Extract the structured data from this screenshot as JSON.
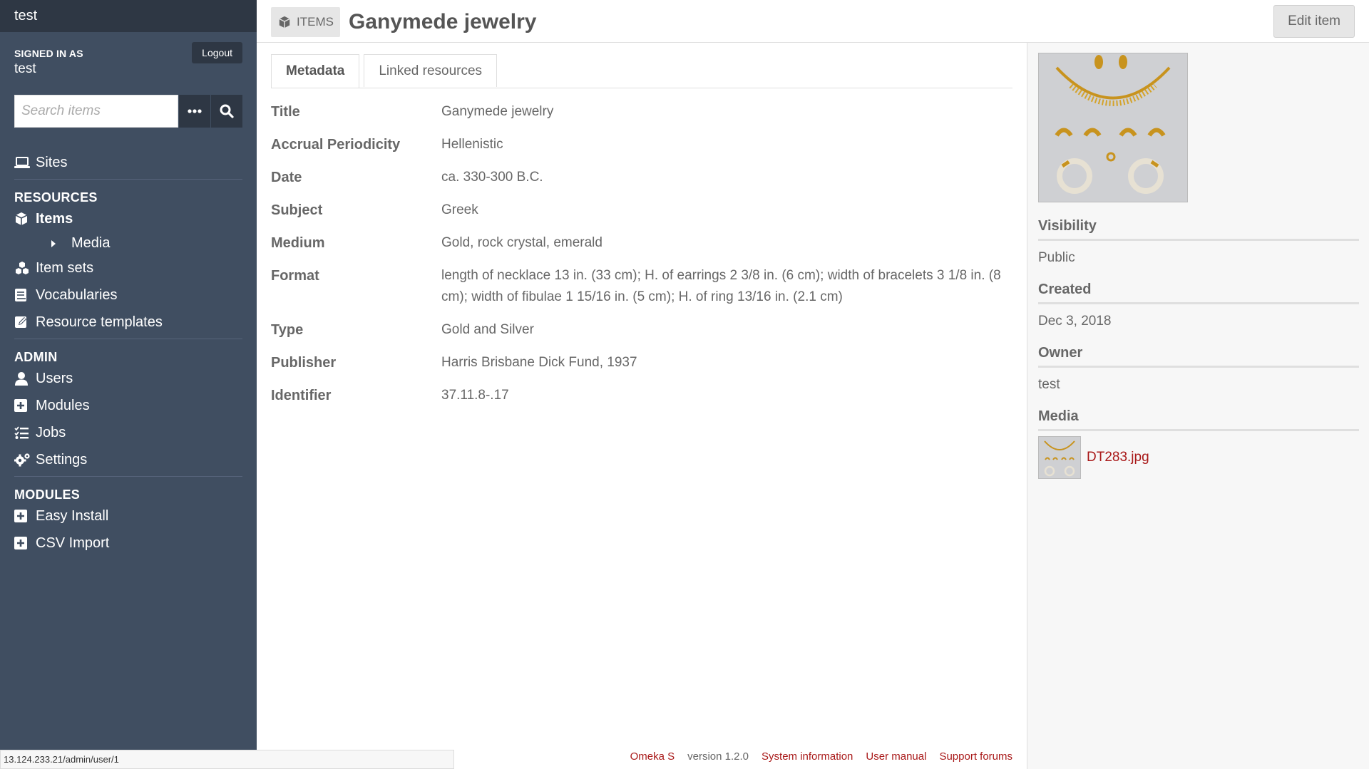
{
  "sidebar": {
    "site_title": "test",
    "signed_in_label": "SIGNED IN AS",
    "user_name": "test",
    "logout_label": "Logout",
    "search_placeholder": "Search items",
    "nav": {
      "sites": "Sites",
      "resources_heading": "RESOURCES",
      "items": "Items",
      "media": "Media",
      "item_sets": "Item sets",
      "vocabularies": "Vocabularies",
      "resource_templates": "Resource templates",
      "admin_heading": "ADMIN",
      "users": "Users",
      "modules": "Modules",
      "jobs": "Jobs",
      "settings": "Settings",
      "modules_heading": "MODULES",
      "easy_install": "Easy Install",
      "csv_import": "CSV Import"
    }
  },
  "header": {
    "section": "ITEMS",
    "title": "Ganymede jewelry",
    "edit_label": "Edit item"
  },
  "tabs": [
    "Metadata",
    "Linked resources"
  ],
  "properties": [
    {
      "label": "Title",
      "value": "Ganymede jewelry"
    },
    {
      "label": "Accrual Periodicity",
      "value": "Hellenistic"
    },
    {
      "label": "Date",
      "value": "ca. 330-300 B.C."
    },
    {
      "label": "Subject",
      "value": "Greek"
    },
    {
      "label": "Medium",
      "value": "Gold, rock crystal, emerald"
    },
    {
      "label": "Format",
      "value": "length of necklace 13 in. (33 cm); H. of earrings 2 3/8 in. (6 cm); width of bracelets 3 1/8 in. (8 cm); width of fibulae 1 15/16 in. (5 cm); H. of ring 13/16 in. (2.1 cm)"
    },
    {
      "label": "Type",
      "value": "Gold and Silver"
    },
    {
      "label": "Publisher",
      "value": "Harris Brisbane Dick Fund, 1937"
    },
    {
      "label": "Identifier",
      "value": "37.11.8-.17"
    }
  ],
  "right_panel": {
    "visibility_heading": "Visibility",
    "visibility_value": "Public",
    "created_heading": "Created",
    "created_value": "Dec 3, 2018",
    "owner_heading": "Owner",
    "owner_value": "test",
    "media_heading": "Media",
    "media_file": "DT283.jpg"
  },
  "footer": {
    "omeka": "Omeka S",
    "version": "version 1.2.0",
    "system_info": "System information",
    "user_manual": "User manual",
    "support": "Support forums"
  },
  "status_url": "13.124.233.21/admin/user/1",
  "colors": {
    "sidebar_bg": "#404e61",
    "sidebar_dark": "#2e3744",
    "link": "#a91919"
  }
}
